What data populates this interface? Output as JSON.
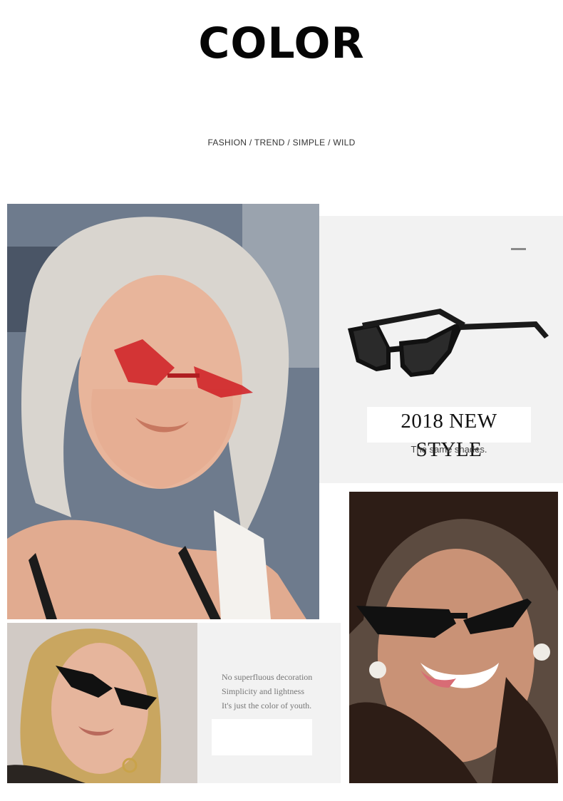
{
  "header": {
    "title": "COLOR",
    "subtitle": "FASHION / TREND / SIMPLE / WILD"
  },
  "product_panel": {
    "headline": "2018 NEW STYLE",
    "caption": "The same shades."
  },
  "quote_panel": {
    "lines": [
      "No superfluous decoration",
      "Simplicity and lightness",
      "It's just the color of youth."
    ]
  },
  "colors": {
    "red_lens": "#d0262a",
    "black_frame": "#111111",
    "panel_bg": "#f2f2f2"
  }
}
